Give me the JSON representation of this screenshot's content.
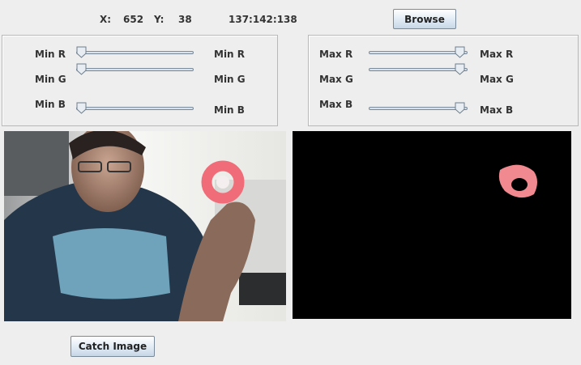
{
  "header": {
    "x_label": "X:",
    "x_value": "652",
    "y_label": "Y:",
    "y_value": "38",
    "rgb_value": "137:142:138",
    "browse_label": "Browse"
  },
  "min_panel": {
    "sliders": [
      {
        "label_left": "Min R",
        "label_right": "Min R",
        "value": 0
      },
      {
        "label_left": "Min G",
        "label_right": "Min G",
        "value": 0
      },
      {
        "label_left": "Min B",
        "label_right": "Min B",
        "value": 0
      }
    ]
  },
  "max_panel": {
    "sliders": [
      {
        "label_left": "Max R",
        "label_right": "Max R",
        "value": 255
      },
      {
        "label_left": "Max G",
        "label_right": "Max G",
        "value": 255
      },
      {
        "label_left": "Max B",
        "label_right": "Max B",
        "value": 255
      }
    ]
  },
  "footer": {
    "catch_label": "Catch Image"
  },
  "colors": {
    "window_bg": "#eeeeee",
    "mask_bg": "#000000",
    "detected_ring": "#f08a90"
  }
}
